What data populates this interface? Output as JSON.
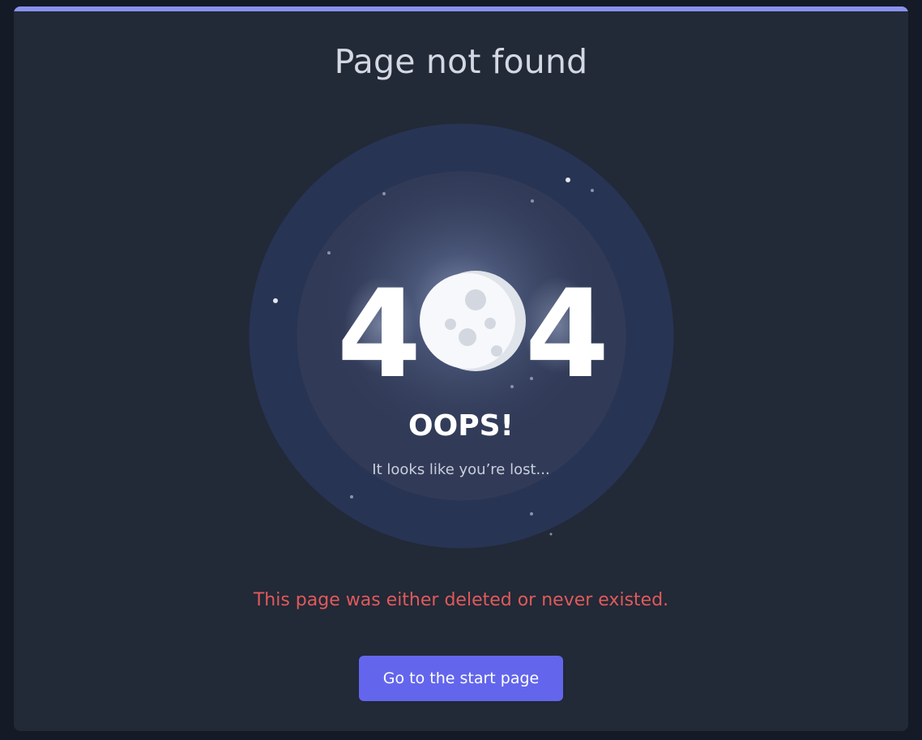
{
  "page": {
    "title": "Page not found"
  },
  "illustration": {
    "digits_left": "4",
    "digits_right": "4",
    "icon": "moon-icon",
    "headline": "OOPS!",
    "subtext": "It looks like you’re lost..."
  },
  "message": {
    "text": "This page was either deleted or never existed."
  },
  "actions": {
    "start_page_label": "Go to the start page"
  },
  "colors": {
    "background": "#141a26",
    "card": "#222937",
    "accent_bar": "#8a92ec",
    "error_text": "#e05a5a",
    "primary_button": "#6366ec"
  }
}
